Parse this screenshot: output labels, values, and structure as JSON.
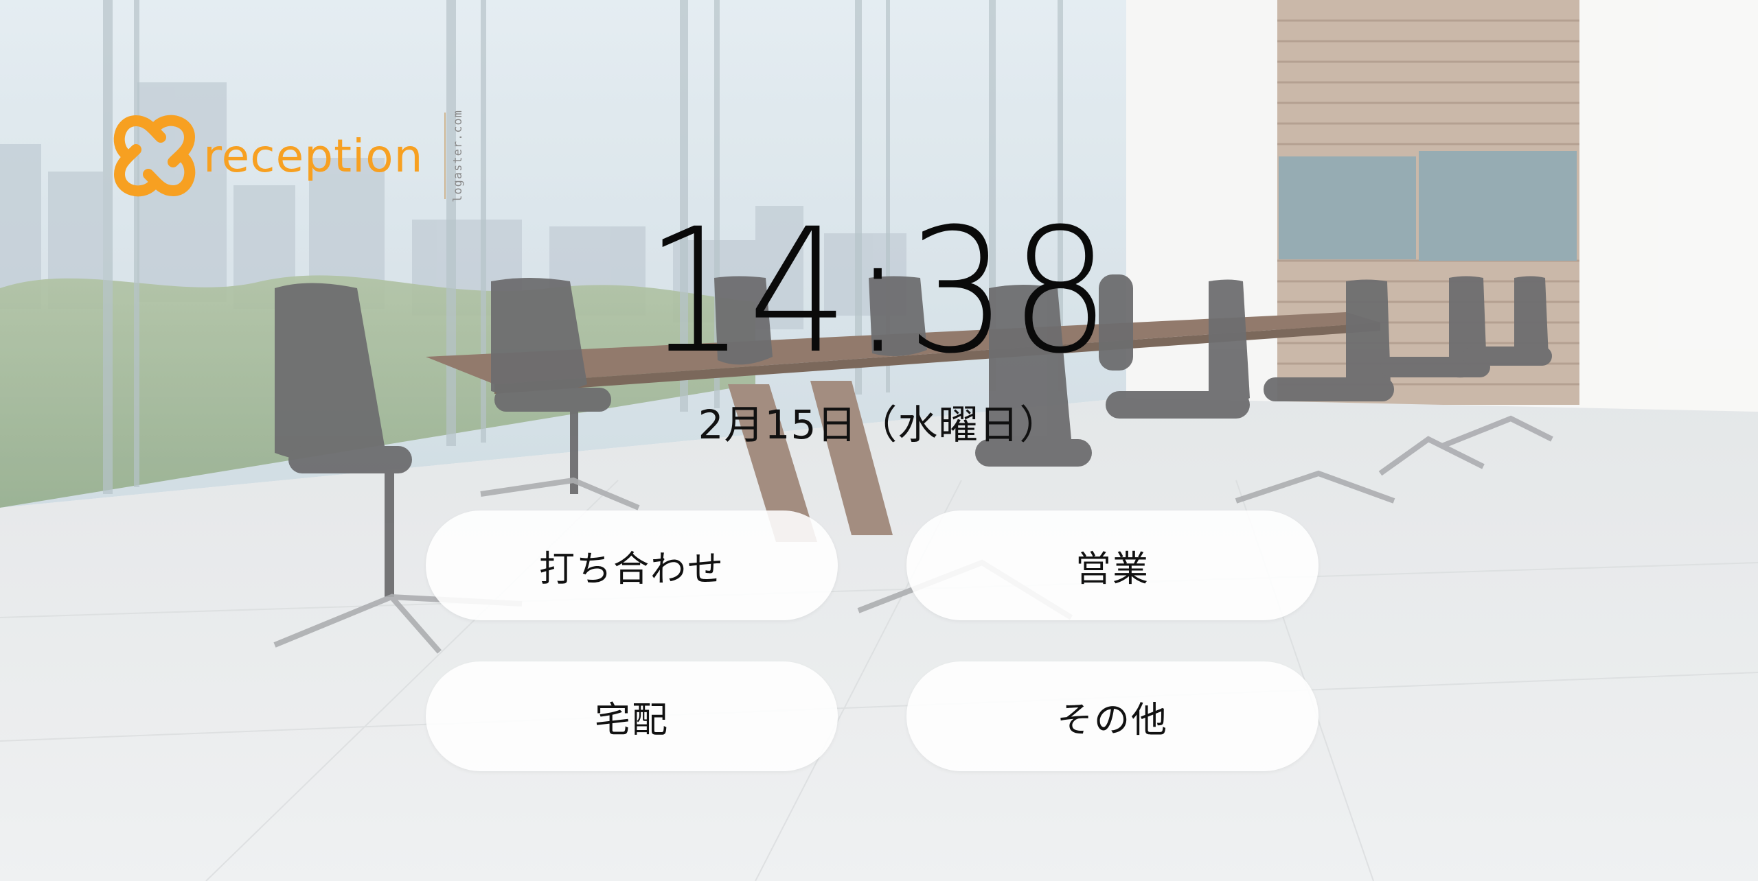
{
  "brand": {
    "name": "reception",
    "site": "logaster.com",
    "color": "#f7a021",
    "logo_icon": "interlocking-loops-logo"
  },
  "clock": {
    "time": "14:38",
    "date": "2月15日（水曜日）"
  },
  "buttons": [
    {
      "label": "打ち合わせ",
      "icon": null
    },
    {
      "label": "営業",
      "icon": null
    },
    {
      "label": "宅配",
      "icon": null
    },
    {
      "label": "その他",
      "icon": null
    }
  ],
  "background": {
    "scene": "conference-room-photo"
  }
}
